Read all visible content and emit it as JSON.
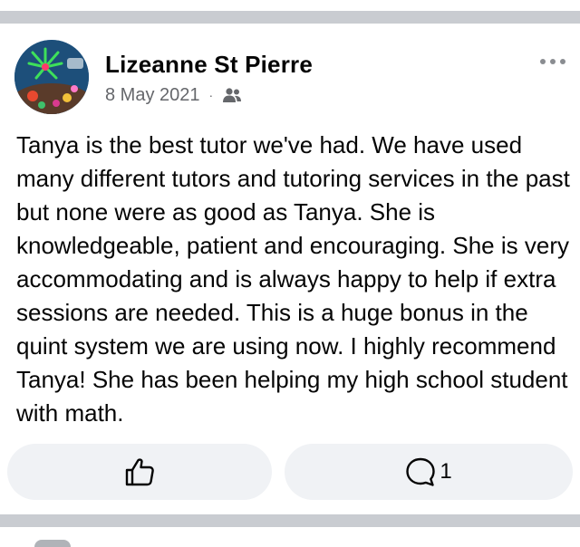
{
  "post": {
    "author": "Lizeanne St Pierre",
    "date": "8 May 2021",
    "separator": "·",
    "audience_icon": "friends-icon",
    "text": "Tanya is the best tutor we've had. We have used many different tutors and tutoring services in the past but none were as good as Tanya. She is knowledgeable, patient and encouraging. She is very accommodating and is always happy to help if extra sessions are needed. This is a huge bonus in the quint system we are using now. I highly recommend Tanya! She has been helping my high school student with math.",
    "comment_count": "1"
  },
  "colors": {
    "divider": "#c9ccd1",
    "button_bg": "#f0f2f5",
    "meta_text": "#65676b",
    "body_text": "#050505"
  }
}
